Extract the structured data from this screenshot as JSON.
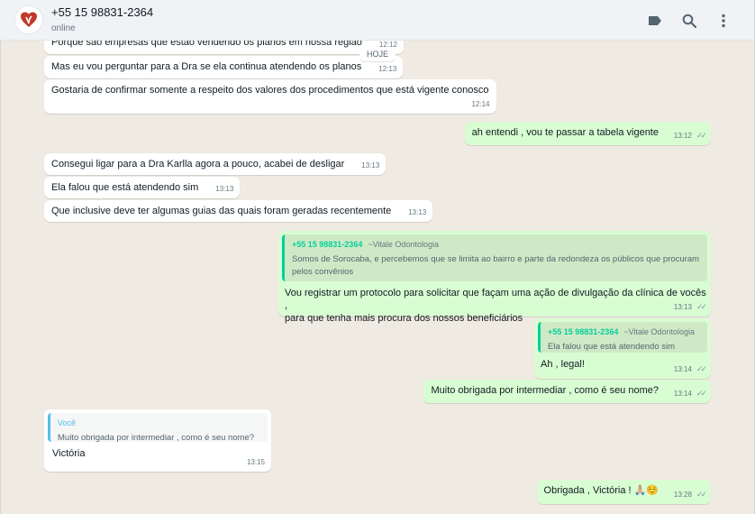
{
  "header": {
    "contact_name": "+55 15 98831-2364",
    "status": "online",
    "icons": [
      "label-icon",
      "search-icon",
      "menu-icon"
    ]
  },
  "date_divider": "HOJE",
  "messages": [
    {
      "id": "m0",
      "dir": "in",
      "text": "Porque são empresas que estão vendendo os planos em nossa região",
      "time": "12:12"
    },
    {
      "id": "m1",
      "dir": "in",
      "text": "Mas eu vou perguntar para a Dra se ela continua atendendo os planos",
      "time": "12:13"
    },
    {
      "id": "m2",
      "dir": "in",
      "text": "Gostaria de confirmar somente a respeito dos valores dos procedimentos que está vigente conosco",
      "time": "12:14"
    },
    {
      "id": "m3",
      "dir": "out",
      "text": "ah entendi , vou te passar a tabela vigente",
      "time": "13:12"
    },
    {
      "id": "m4",
      "dir": "in",
      "text": "Consegui ligar para a Dra Karlla agora a pouco, acabei de desligar",
      "time": "13:13"
    },
    {
      "id": "m5",
      "dir": "in",
      "text": "Ela falou que está atendendo sim",
      "time": "13:13"
    },
    {
      "id": "m6",
      "dir": "in",
      "text": "Que inclusive deve ter algumas guias das quais foram geradas recentemente",
      "time": "13:13"
    },
    {
      "id": "m7",
      "dir": "out",
      "quote": {
        "author": "+55 15 98831-2364",
        "alias": "~Vitale Odontologia",
        "text": "Somos de Sorocaba, e percebemos que se limita ao bairro e parte da redondeza os públicos que procuram pelos convênios"
      },
      "text_lines": [
        "Vou registrar um protocolo para solicitar que façam uma ação de divulgação da clínica de vocês ,",
        "para que tenha mais procura dos nossos beneficiários"
      ],
      "time": "13:13"
    },
    {
      "id": "m8",
      "dir": "out",
      "quote": {
        "author": "+55 15 98831-2364",
        "alias": "~Vitale Odontologia",
        "text": "Ela falou que está atendendo sim"
      },
      "text": "Ah , legal!",
      "time": "13:14"
    },
    {
      "id": "m9",
      "dir": "out",
      "text": "Muito obrigada por intermediar , como é seu nome?",
      "time": "13:14"
    },
    {
      "id": "m10",
      "dir": "in",
      "quote": {
        "author": "Você",
        "text": "Muito obrigada por intermediar , como é seu nome?"
      },
      "text": "Victória",
      "time": "13:15"
    },
    {
      "id": "m11",
      "dir": "out",
      "text": "Obrigada , Victória ! 🙏🏼☺️",
      "time": "13:28"
    }
  ]
}
